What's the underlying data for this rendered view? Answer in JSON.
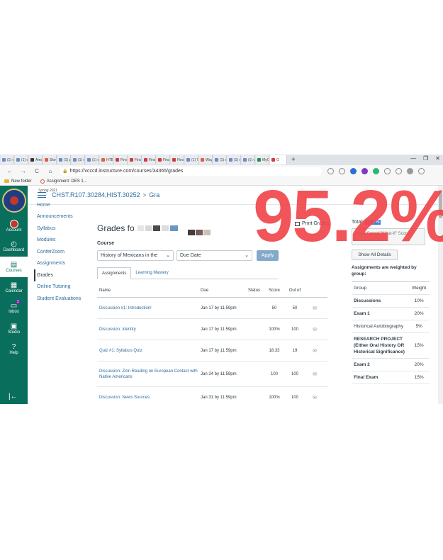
{
  "browser": {
    "tabs": [
      {
        "label": "(1) cu",
        "color": "#6c8ebf"
      },
      {
        "label": "(1) cu",
        "color": "#6c8ebf"
      },
      {
        "label": "Amaz",
        "color": "#333333"
      },
      {
        "label": "Sketc",
        "color": "#e0623b"
      },
      {
        "label": "(1) p",
        "color": "#6c8ebf"
      },
      {
        "label": "(1) cu",
        "color": "#6c8ebf"
      },
      {
        "label": "(1) cu",
        "color": "#6c8ebf"
      },
      {
        "label": "HTB",
        "color": "#e0623b"
      },
      {
        "label": "Final",
        "color": "#d33b3b"
      },
      {
        "label": "Final",
        "color": "#d33b3b"
      },
      {
        "label": "Final",
        "color": "#d33b3b"
      },
      {
        "label": "Final",
        "color": "#d33b3b"
      },
      {
        "label": "Final",
        "color": "#d33b3b"
      },
      {
        "label": "(1) Tr",
        "color": "#6c8ebf"
      },
      {
        "label": "Wayf",
        "color": "#e0623b"
      },
      {
        "label": "(1) st",
        "color": "#6c8ebf"
      },
      {
        "label": "(1) st",
        "color": "#6c8ebf"
      },
      {
        "label": "(1) vc",
        "color": "#6c8ebf"
      },
      {
        "label": "MyCo",
        "color": "#2a8c4a"
      },
      {
        "label": "G",
        "color": "#d33b3b",
        "active": true
      }
    ],
    "new_tab": "+",
    "win_min": "—",
    "win_max": "❐",
    "win_close": "✕",
    "back": "←",
    "forward": "→",
    "reload": "C",
    "home": "⌂",
    "url": "https://vcccd.instructure.com/courses/34365/grades",
    "bookmarks": [
      {
        "label": "New folder",
        "type": "folder"
      },
      {
        "label": "Assignment: DES 1...",
        "type": "link"
      }
    ]
  },
  "globalnav": {
    "items": [
      {
        "label": "Account",
        "icon": "account-icon",
        "glyph": ""
      },
      {
        "label": "Dashboard",
        "icon": "dashboard-icon",
        "glyph": "◴"
      },
      {
        "label": "Courses",
        "icon": "courses-icon",
        "glyph": "▤",
        "active": true
      },
      {
        "label": "Calendar",
        "icon": "calendar-icon",
        "glyph": "▦"
      },
      {
        "label": "Inbox",
        "icon": "inbox-icon",
        "glyph": "▭",
        "badge": "2"
      },
      {
        "label": "Studio",
        "icon": "studio-icon",
        "glyph": "▣"
      },
      {
        "label": "Help",
        "icon": "help-icon",
        "glyph": "?"
      }
    ],
    "collapse": "|←"
  },
  "header": {
    "course": "CHST.R107.30284;HIST.30252",
    "separator": ">",
    "current": "Gra"
  },
  "coursenav": {
    "term": "Spring 2021",
    "items": [
      {
        "label": "Home"
      },
      {
        "label": "Announcements"
      },
      {
        "label": "Syllabus"
      },
      {
        "label": "Modules"
      },
      {
        "label": "ConferZoom"
      },
      {
        "label": "Assignments"
      },
      {
        "label": "Grades",
        "active": true
      },
      {
        "label": "Online Tutoring"
      },
      {
        "label": "Student Evaluations"
      }
    ]
  },
  "main": {
    "title": "Grades fo",
    "print": "Print Grades",
    "course_label": "Course",
    "course_select": "History of Mexicans in the",
    "sort_select": "Due Date",
    "apply": "Apply",
    "tabs": [
      {
        "label": "Assignments",
        "active": true
      },
      {
        "label": "Learning Mastery"
      }
    ],
    "columns": {
      "name": "Name",
      "due": "Due",
      "status": "Status",
      "score": "Score",
      "out": "Out of"
    },
    "rows": [
      {
        "name": "Discussion #1: Introduction!",
        "due": "Jan 17 by 11:59pm",
        "status": "",
        "score": "50",
        "out": "50"
      },
      {
        "name": "Discussion: Identity",
        "due": "Jan 17 by 11:59pm",
        "status": "",
        "score": "100%",
        "out": "100"
      },
      {
        "name": "Quiz #1: Syllabus Quiz",
        "due": "Jan 17 by 11:59pm",
        "status": "",
        "score": "18.33",
        "out": "19"
      },
      {
        "name": "Discussion: Zinn Reading on European Contact with Native Americans",
        "due": "Jan 24 by 11:59pm",
        "status": "",
        "score": "100",
        "out": "100"
      },
      {
        "name": "Discussion: News Sources",
        "due": "Jan 31 by 11:59pm",
        "status": "",
        "score": "100%",
        "out": "100"
      }
    ]
  },
  "sidebar": {
    "total_label": "Total:",
    "total_value": "95.2%",
    "whatif": "Show Saved \"What-If\" Scores",
    "show_all": "Show All Details",
    "weighted": "Assignments are weighted by group:",
    "weights_head": {
      "group": "Group",
      "weight": "Weight"
    },
    "weights": [
      {
        "group": "Discussions",
        "weight": "10%"
      },
      {
        "group": "Exam 1",
        "weight": "20%"
      },
      {
        "group": "Historical Autobiography",
        "weight": "5%"
      },
      {
        "group": "RESEARCH PROJECT (Either Oral History OR Historical Significance)",
        "weight": "15%"
      },
      {
        "group": "Exam 2",
        "weight": "20%"
      },
      {
        "group": "Final Exam",
        "weight": "15%"
      }
    ]
  },
  "overlay": {
    "text": "95.2%"
  },
  "colors": {
    "nav": "#0a6e5c",
    "link": "#2d6d9c",
    "overlay": "#f0484d",
    "highlight": "#3b82dd"
  }
}
